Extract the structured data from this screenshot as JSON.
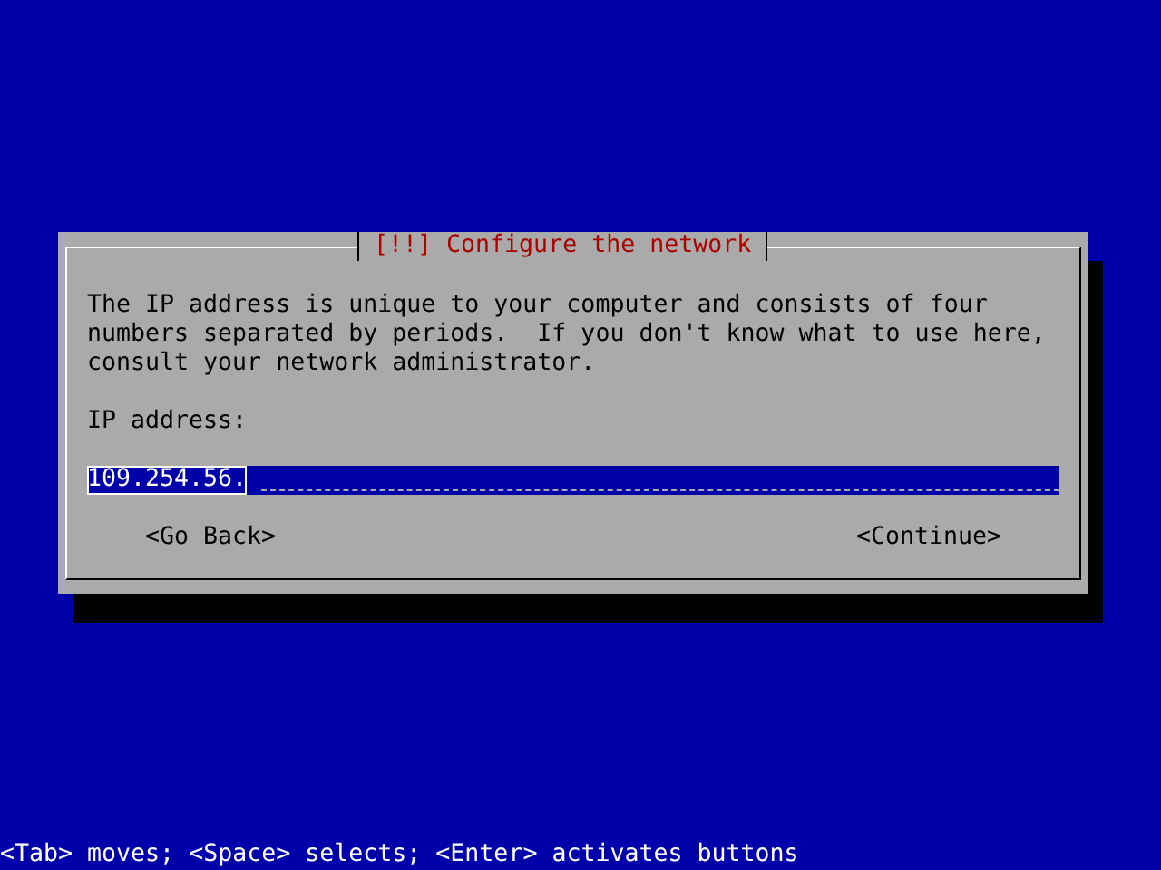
{
  "dialog": {
    "title": "[!!] Configure the network",
    "description": "The IP address is unique to your computer and consists of four\nnumbers separated by periods.  If you don't know what to use here,\nconsult your network administrator.",
    "field": {
      "label": "IP address:",
      "value": "109.254.56.",
      "selected": true
    },
    "buttons": [
      {
        "label": "<Go Back>",
        "selected": false
      },
      {
        "label": "<Continue>",
        "selected": false
      }
    ]
  },
  "status_bar": "<Tab> moves; <Space> selects; <Enter> activates buttons"
}
